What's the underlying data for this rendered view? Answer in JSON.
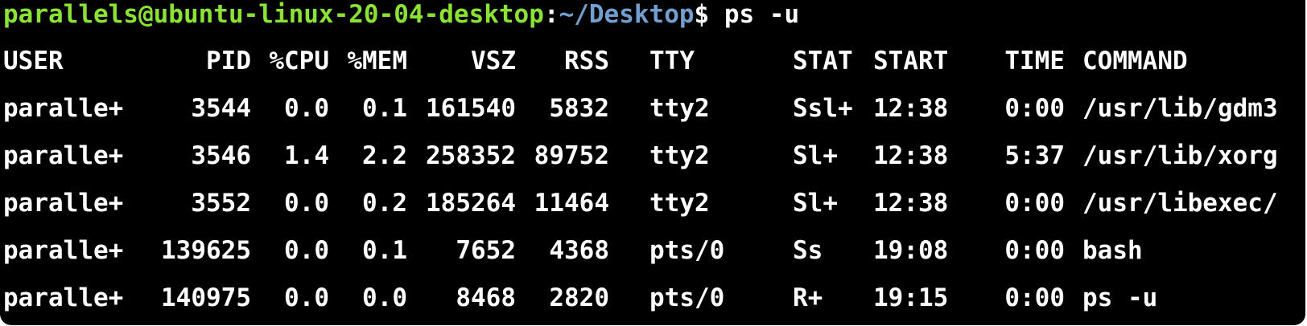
{
  "window": {
    "background": "#000000",
    "text_color": "#ffffff"
  },
  "prompt": {
    "user_host": "parallels@ubuntu-linux-20-04-desktop",
    "separator": ":",
    "path": "~/Desktop",
    "symbol": "$",
    "command": "ps -u",
    "colors": {
      "user_host": "#8ae234",
      "path": "#729fcf"
    }
  },
  "table": {
    "headers": {
      "user": "USER",
      "pid": "PID",
      "cpu": "%CPU",
      "mem": "%MEM",
      "vsz": "VSZ",
      "rss": "RSS",
      "tty": "TTY",
      "stat": "STAT",
      "start": "START",
      "time": "TIME",
      "command": "COMMAND"
    },
    "rows": [
      {
        "user": "paralle+",
        "pid": "3544",
        "cpu": "0.0",
        "mem": "0.1",
        "vsz": "161540",
        "rss": "5832",
        "tty": "tty2",
        "stat": "Ssl+",
        "start": "12:38",
        "time": "0:00",
        "command": "/usr/lib/gdm3"
      },
      {
        "user": "paralle+",
        "pid": "3546",
        "cpu": "1.4",
        "mem": "2.2",
        "vsz": "258352",
        "rss": "89752",
        "tty": "tty2",
        "stat": "Sl+",
        "start": "12:38",
        "time": "5:37",
        "command": "/usr/lib/xorg"
      },
      {
        "user": "paralle+",
        "pid": "3552",
        "cpu": "0.0",
        "mem": "0.2",
        "vsz": "185264",
        "rss": "11464",
        "tty": "tty2",
        "stat": "Sl+",
        "start": "12:38",
        "time": "0:00",
        "command": "/usr/libexec/"
      },
      {
        "user": "paralle+",
        "pid": "139625",
        "cpu": "0.0",
        "mem": "0.1",
        "vsz": "7652",
        "rss": "4368",
        "tty": "pts/0",
        "stat": "Ss",
        "start": "19:08",
        "time": "0:00",
        "command": "bash"
      },
      {
        "user": "paralle+",
        "pid": "140975",
        "cpu": "0.0",
        "mem": "0.0",
        "vsz": "8468",
        "rss": "2820",
        "tty": "pts/0",
        "stat": "R+",
        "start": "19:15",
        "time": "0:00",
        "command": "ps -u"
      }
    ]
  }
}
